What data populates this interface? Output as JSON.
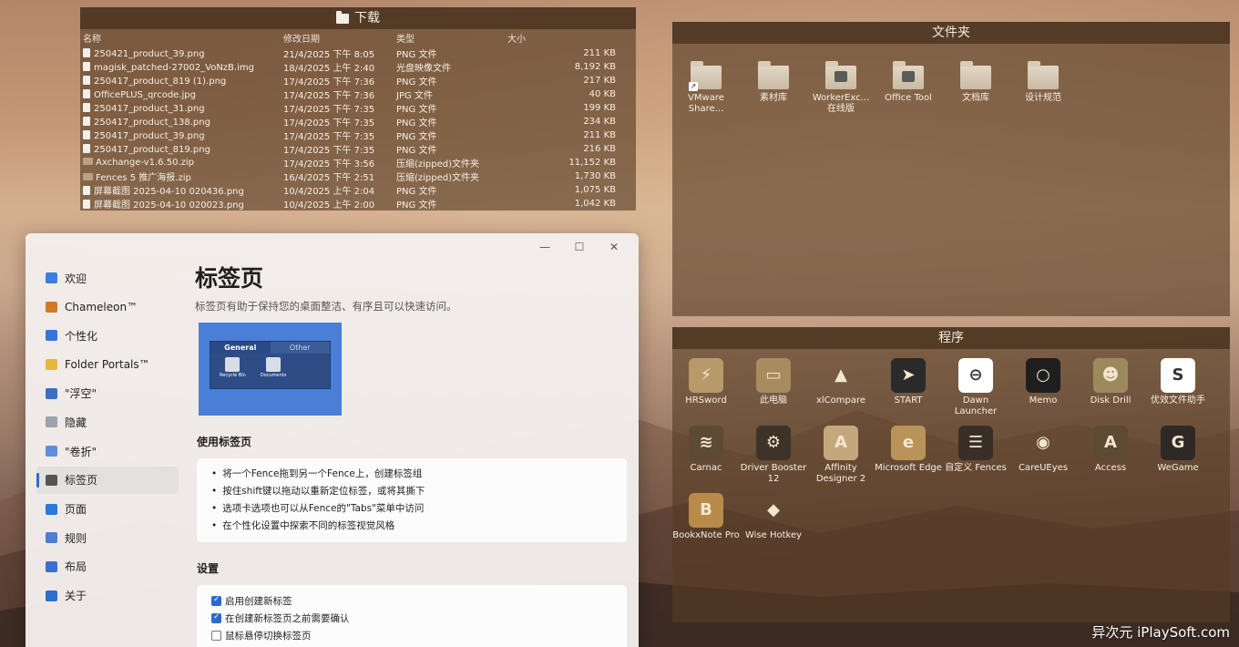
{
  "downloads": {
    "title": "下载",
    "columns": [
      "名称",
      "修改日期",
      "类型",
      "大小"
    ],
    "rows": [
      {
        "name": "250421_product_39.png",
        "date": "21/4/2025 下午 8:05",
        "type": "PNG 文件",
        "size": "211 KB",
        "icon": "file"
      },
      {
        "name": "magisk_patched-27002_VoNzB.img",
        "date": "18/4/2025 上午 2:40",
        "type": "光盘映像文件",
        "size": "8,192 KB",
        "icon": "file"
      },
      {
        "name": "250417_product_819 (1).png",
        "date": "17/4/2025 下午 7:36",
        "type": "PNG 文件",
        "size": "217 KB",
        "icon": "file"
      },
      {
        "name": "OfficePLUS_qrcode.jpg",
        "date": "17/4/2025 下午 7:36",
        "type": "JPG 文件",
        "size": "40 KB",
        "icon": "file"
      },
      {
        "name": "250417_product_31.png",
        "date": "17/4/2025 下午 7:35",
        "type": "PNG 文件",
        "size": "199 KB",
        "icon": "file"
      },
      {
        "name": "250417_product_138.png",
        "date": "17/4/2025 下午 7:35",
        "type": "PNG 文件",
        "size": "234 KB",
        "icon": "file"
      },
      {
        "name": "250417_product_39.png",
        "date": "17/4/2025 下午 7:35",
        "type": "PNG 文件",
        "size": "211 KB",
        "icon": "file"
      },
      {
        "name": "250417_product_819.png",
        "date": "17/4/2025 下午 7:35",
        "type": "PNG 文件",
        "size": "216 KB",
        "icon": "file"
      },
      {
        "name": "Axchange-v1.6.50.zip",
        "date": "17/4/2025 下午 3:56",
        "type": "压缩(zipped)文件夹",
        "size": "11,152 KB",
        "icon": "zip"
      },
      {
        "name": "Fences 5 推广海报.zip",
        "date": "16/4/2025 下午 2:51",
        "type": "压缩(zipped)文件夹",
        "size": "1,730 KB",
        "icon": "zip"
      },
      {
        "name": "屏幕截图 2025-04-10 020436.png",
        "date": "10/4/2025 上午 2:04",
        "type": "PNG 文件",
        "size": "1,075 KB",
        "icon": "file"
      },
      {
        "name": "屏幕截图 2025-04-10 020023.png",
        "date": "10/4/2025 上午 2:00",
        "type": "PNG 文件",
        "size": "1,042 KB",
        "icon": "file"
      }
    ]
  },
  "folders": {
    "title": "文件夹",
    "items": [
      "VMware Share...",
      "素材库",
      "WorkerExc... 在线版",
      "Office Tool",
      "文档库",
      "设计规范"
    ]
  },
  "programs": {
    "title": "程序",
    "items": [
      {
        "label": "HRSword",
        "icon": "hrsword-icon",
        "bg": "#b89a6a",
        "glyph": "⚡"
      },
      {
        "label": "此电脑",
        "icon": "computer-icon",
        "bg": "#a88c60",
        "glyph": "▭"
      },
      {
        "label": "xlCompare",
        "icon": "xlcompare-icon",
        "bg": "transparent",
        "glyph": "▲"
      },
      {
        "label": "START",
        "icon": "start-icon",
        "bg": "#2a2a2a",
        "glyph": "➤"
      },
      {
        "label": "Dawn Launcher",
        "icon": "dawn-launcher-icon",
        "bg": "#ffffff",
        "glyph": "⊖"
      },
      {
        "label": "Memo",
        "icon": "memo-icon",
        "bg": "#1e1e1e",
        "glyph": "○"
      },
      {
        "label": "Disk Drill",
        "icon": "disk-drill-icon",
        "bg": "#9c8a5c",
        "glyph": "☻"
      },
      {
        "label": "优效文件助手",
        "icon": "file-helper-icon",
        "bg": "#ffffff",
        "glyph": "S"
      },
      {
        "label": "Carnac",
        "icon": "carnac-icon",
        "bg": "#5d4a35",
        "glyph": "≋"
      },
      {
        "label": "Driver Booster 12",
        "icon": "driver-booster-icon",
        "bg": "#3e3328",
        "glyph": "⚙"
      },
      {
        "label": "Affinity Designer 2",
        "icon": "affinity-designer-icon",
        "bg": "#c4a77d",
        "glyph": "A"
      },
      {
        "label": "Microsoft Edge",
        "icon": "edge-icon",
        "bg": "#b89458",
        "glyph": "e"
      },
      {
        "label": "自定义 Fences",
        "icon": "fences-icon",
        "bg": "#3a2f26",
        "glyph": "☰"
      },
      {
        "label": "CareUEyes",
        "icon": "careueyes-icon",
        "bg": "transparent",
        "glyph": "◉"
      },
      {
        "label": "Access",
        "icon": "access-icon",
        "bg": "#5d4a35",
        "glyph": "A"
      },
      {
        "label": "WeGame",
        "icon": "wegame-icon",
        "bg": "#2e2924",
        "glyph": "G"
      },
      {
        "label": "BookxNote Pro",
        "icon": "bookxnote-icon",
        "bg": "#b88b4a",
        "glyph": "B"
      },
      {
        "label": "Wise Hotkey",
        "icon": "wise-hotkey-icon",
        "bg": "transparent",
        "glyph": "◆"
      }
    ]
  },
  "settings": {
    "window_controls": {
      "minimize": "—",
      "maximize": "☐",
      "close": "✕"
    },
    "nav": [
      {
        "label": "欢迎",
        "color": "#3b7de0"
      },
      {
        "label": "Chameleon™",
        "color": "#d07a2a"
      },
      {
        "label": "个性化",
        "color": "#2e7ad4"
      },
      {
        "label": "Folder Portals™",
        "color": "#e8b73a"
      },
      {
        "label": "\"浮空\"",
        "color": "#3a6fc4"
      },
      {
        "label": "隐藏",
        "color": "#9aa3ae"
      },
      {
        "label": "\"卷折\"",
        "color": "#5f8fd6"
      },
      {
        "label": "标签页",
        "color": "#555555"
      },
      {
        "label": "页面",
        "color": "#2b78d6"
      },
      {
        "label": "规则",
        "color": "#4b7fd1"
      },
      {
        "label": "布局",
        "color": "#3b6fd0"
      },
      {
        "label": "关于",
        "color": "#2d6fcc"
      }
    ],
    "active_index": 7,
    "title": "标签页",
    "description": "标签页有助于保持您的桌面整洁、有序且可以快速访问。",
    "preview": {
      "tab_general": "General",
      "tab_other": "Other",
      "icon1": "Recycle Bin",
      "icon2": "Documents"
    },
    "usage_title": "使用标签页",
    "usage_items": [
      "将一个Fence拖到另一个Fence上，创建标签组",
      "按住shift键以拖动以重新定位标签，或将其撕下",
      "选项卡选项也可以从Fence的\"Tabs\"菜单中访问",
      "在个性化设置中探索不同的标签视觉风格"
    ],
    "settings_title": "设置",
    "options": [
      {
        "label": "启用创建新标签",
        "checked": true
      },
      {
        "label": "在创建新标签页之前需要确认",
        "checked": true
      },
      {
        "label": "鼠标悬停切换标签页",
        "checked": false
      }
    ]
  },
  "watermark": "异次元 iPlaySoft.com"
}
